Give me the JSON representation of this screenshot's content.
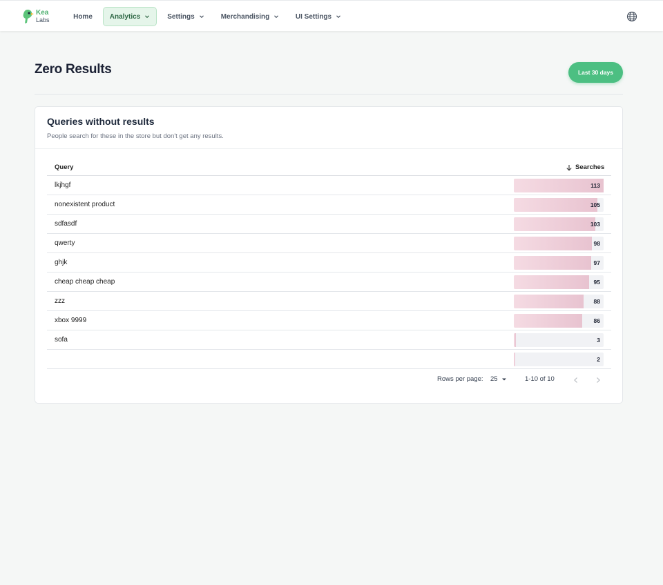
{
  "brand": {
    "line1": "Kea",
    "line2": "Labs"
  },
  "nav": {
    "items": [
      {
        "label": "Home"
      },
      {
        "label": "Analytics"
      },
      {
        "label": "Settings"
      },
      {
        "label": "Merchandising"
      },
      {
        "label": "UI Settings"
      }
    ],
    "active": "Analytics",
    "globe_icon": "globe-icon"
  },
  "page": {
    "title": "Zero Results",
    "range_button": "Last 30 days"
  },
  "card": {
    "title": "Queries without results",
    "subtitle": "People search for these in the store but don't get any results.",
    "columns": {
      "query": "Query",
      "searches": "Searches"
    },
    "sort": "descending",
    "max_value": 113,
    "rows": [
      {
        "query": "lkjhgf",
        "searches": "113"
      },
      {
        "query": "nonexistent product",
        "searches": "105"
      },
      {
        "query": "sdfasdf",
        "searches": "103"
      },
      {
        "query": "qwerty",
        "searches": "98"
      },
      {
        "query": "ghjk",
        "searches": "97"
      },
      {
        "query": "cheap cheap cheap",
        "searches": "95"
      },
      {
        "query": "zzz",
        "searches": "88"
      },
      {
        "query": "xbox 9999",
        "searches": "86"
      },
      {
        "query": "sofa",
        "searches": "3"
      },
      {
        "query": "",
        "searches": "2"
      }
    ],
    "footer": {
      "rows_per_page_label": "Rows per page:",
      "rows_per_page_value": "25",
      "range": "1-10 of 10"
    }
  },
  "colors": {
    "accent": "#4cbf82",
    "nav_active_bg": "#e5f5ea",
    "bar_start": "#f5dbe3",
    "bar_end": "#e8c3d0",
    "background": "#f5f7f6"
  }
}
